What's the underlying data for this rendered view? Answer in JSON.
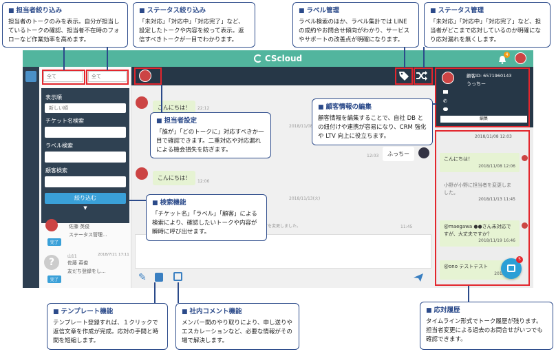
{
  "brand": {
    "name": "CScloud"
  },
  "list": {
    "filter_left": "全て",
    "filter_right": "全て",
    "panel": {
      "order_label": "表示順",
      "order_value": "新しい順",
      "ticket_label": "チケット名検索",
      "label_label": "ラベル検索",
      "customer_label": "顧客検索",
      "submit": "絞り込む"
    },
    "items": [
      {
        "name": "佐藤 英俊",
        "preview": "ステータス管理...",
        "status": "完了"
      },
      {
        "name": "佐藤 英俊",
        "preview": "友だち登録をし...",
        "status": "完了",
        "id": "山11",
        "date": "2018/7/21 17:11"
      }
    ]
  },
  "chat": {
    "msg1": "こんにちは！",
    "msg1_time": "22:12",
    "date1": "2018/11/08(木)",
    "msg2": "ふっちー",
    "msg2_time": "12:03",
    "msg3": "こんにちは！",
    "msg3_time": "12:06",
    "date2": "2018/11/13(火)",
    "system_msg": "に担当者を変更しました。",
    "system_time": "11:45",
    "agent_name": "佐藤 英俊"
  },
  "customer": {
    "id_label": "顧客ID: 6571960143",
    "name": "うっちー",
    "edit": "編集"
  },
  "history": [
    {
      "time": "2018/11/08 12:03"
    },
    {
      "text": "こんにちは！",
      "time": "2018/11/08 12:06"
    },
    {
      "text": "小野が小野に担当者を変更しました。",
      "time": "2018/11/13 11:45"
    },
    {
      "text": "@maegawa ●●さん未対応ですが、大丈夫ですか？",
      "time": "2018/11/19 16:46"
    },
    {
      "text": "@ono テストテスト",
      "time": "2018/11/2"
    }
  ],
  "badges": {
    "notif": "4",
    "fab": "5"
  },
  "callouts": {
    "assignee_filter": {
      "title": "担当者絞り込み",
      "body": "担当者のトークのみを表示。自分が担当しているトークの確認、担当者不在時のフォローなど作業効率を高めます。"
    },
    "status_filter": {
      "title": "ステータス絞り込み",
      "body": "「未対応」「対応中」「対応完了」など、設定したトークや内容を絞って表示。返信すべきトークが一目でわかります。"
    },
    "label_mgmt": {
      "title": "ラベル管理",
      "body": "ラベル検索のほか、ラベル集計では LINE の成約やお問合せ傾向がわかり、サービスやサポートの改善点が明確になります。"
    },
    "status_mgmt": {
      "title": "ステータス管理",
      "body": "「未対応」「対応中」「対応完了」など、担当者がどこまで応対しているのか明確になり応対漏れを無くします。"
    },
    "assignee_set": {
      "title": "担当者設定",
      "body": "「誰が」「どのトークに」対応すべきか一目で確認できます。二重対応や対応漏れによる機会損失を防ぎます。"
    },
    "customer_edit": {
      "title": "顧客情報の編集",
      "body": "顧客情報を編集することで、自社 DB との紐付けや連携が容易になり、CRM 強化や LTV 向上に役立ちます。"
    },
    "search": {
      "title": "検索機能",
      "body": "「チケット名」「ラベル」「顧客」による検索により、確認したいトークや内容が瞬時に呼び出せます。"
    },
    "template": {
      "title": "テンプレート機能",
      "body": "テンプレート登録すれば、１クリックで返信文章を作成が完成。応対の手間と時間を短縮します。"
    },
    "comment": {
      "title": "社内コメント機能",
      "body": "メンバー間のやり取りにより、申し送りやエスカレーションなど、必要な情報がその場で解決します。"
    },
    "history": {
      "title": "応対履歴",
      "body": "タイムライン形式でトーク履歴が残ります。担当者変更による過去のお問合せがいつでも確認できます。"
    }
  }
}
